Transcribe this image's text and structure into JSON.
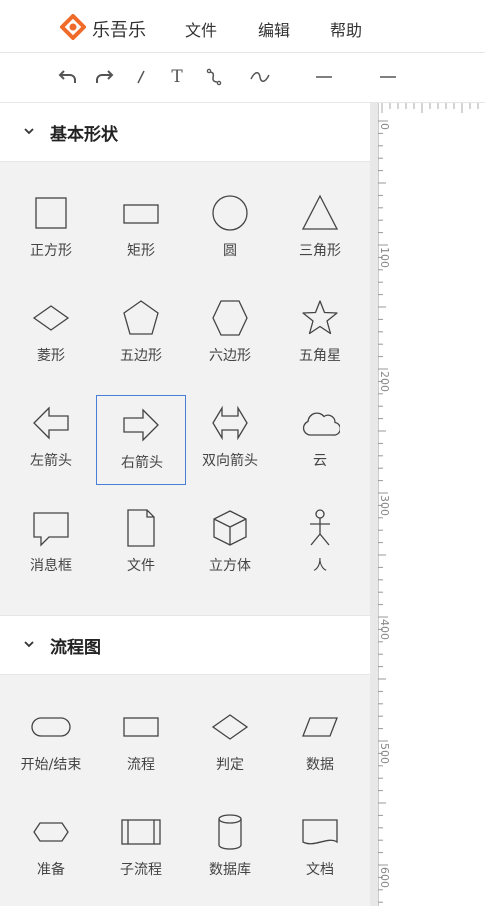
{
  "app": {
    "name": "乐吾乐",
    "brand_color": "#f06a2a"
  },
  "menu": {
    "file": "文件",
    "edit": "编辑",
    "help": "帮助"
  },
  "toolbar": {
    "tools": [
      "undo-icon",
      "redo-icon",
      "line-icon",
      "text-icon",
      "curve-connector-icon",
      "wave-icon",
      "line-style-icon",
      "line-width-icon"
    ],
    "text_tool_label": "T"
  },
  "sections": [
    {
      "title": "基本形状",
      "items": [
        "正方形",
        "矩形",
        "圆",
        "三角形",
        "菱形",
        "五边形",
        "六边形",
        "五角星",
        "左箭头",
        "右箭头",
        "双向箭头",
        "云",
        "消息框",
        "文件",
        "立方体",
        "人"
      ]
    },
    {
      "title": "流程图",
      "items": [
        "开始/结束",
        "流程",
        "判定",
        "数据",
        "准备",
        "子流程",
        "数据库",
        "文档"
      ]
    }
  ],
  "ruler": {
    "labels": [
      "0",
      "100",
      "200",
      "300",
      "400",
      "500",
      "600"
    ]
  }
}
